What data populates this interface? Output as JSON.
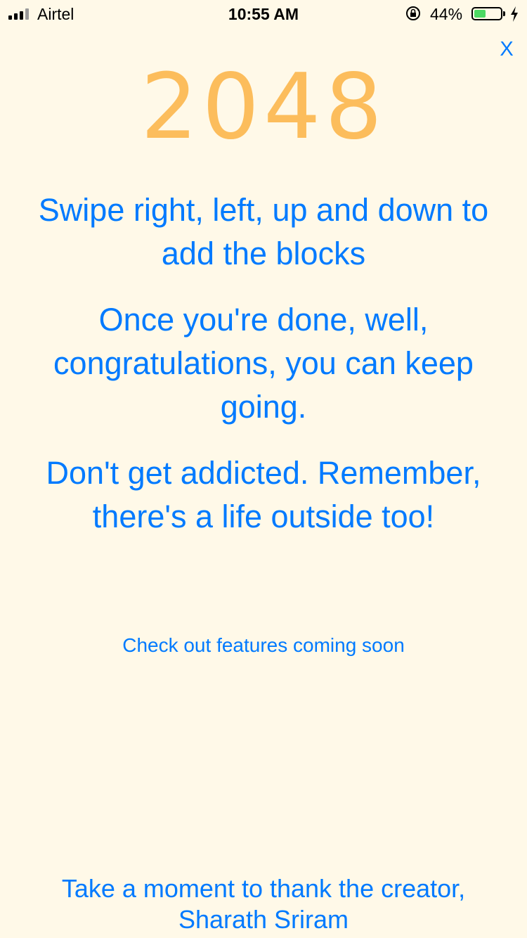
{
  "status_bar": {
    "carrier": "Airtel",
    "time": "10:55 AM",
    "battery_percent": "44%",
    "battery_level": 0.44,
    "signal_icon": "signal-bars-icon",
    "lock_icon": "orientation-lock-icon",
    "charging_icon": "charging-bolt-icon",
    "battery_fill_color": "#4cd964"
  },
  "close_label": "X",
  "logo_text": "2048",
  "paragraphs": [
    "Swipe right, left, up and down to add the blocks",
    "Once you're done, well, congratulations, you can keep going.",
    "Don't get addicted. Remember, there's a life outside too!"
  ],
  "features_link": "Check out features coming soon",
  "thanks": {
    "line1": "Take a moment to thank the creator,",
    "line2": "Sharath Sriram"
  },
  "colors": {
    "background": "#fff9e8",
    "accent": "#007aff",
    "logo": "#fcbd5c"
  }
}
